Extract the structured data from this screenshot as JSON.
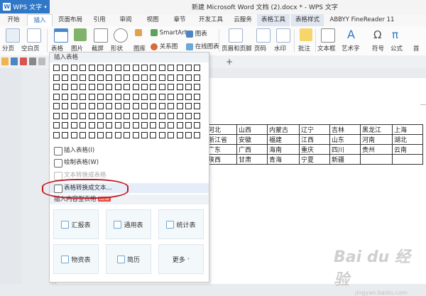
{
  "app": {
    "wps_button": "WPS 文字",
    "window_title": "新建 Microsoft Word 文档 (2).docx * - WPS 文字"
  },
  "tabs": [
    {
      "label": "开始"
    },
    {
      "label": "插入"
    },
    {
      "label": "页面布局"
    },
    {
      "label": "引用"
    },
    {
      "label": "审阅"
    },
    {
      "label": "视图"
    },
    {
      "label": "章节"
    },
    {
      "label": "开发工具"
    },
    {
      "label": "云服务"
    },
    {
      "label": "表格工具"
    },
    {
      "label": "表格样式"
    },
    {
      "label": "ABBYY FineReader 11"
    }
  ],
  "ribbon": {
    "page_break": "分页",
    "blank_page": "空白页",
    "table": "表格",
    "picture": "图片",
    "screenshot": "截屏",
    "shape": "形状",
    "smartart": "SmartArt",
    "chart": "图表",
    "gallery": "图库",
    "relation": "关系图",
    "online_chart": "在线图表",
    "header_footer": "页眉和页脚",
    "page_number": "页码",
    "watermark": "水印",
    "comment": "批注",
    "textbox": "文本框",
    "wordart": "艺术字",
    "symbol": "符号",
    "formula": "公式",
    "more": "首"
  },
  "dropdown": {
    "header": "插入表格",
    "items": [
      {
        "label": "插入表格(I)"
      },
      {
        "label": "绘制表格(W)"
      },
      {
        "label": "文本转换成表格"
      },
      {
        "label": "表格转换成文本..."
      },
      {
        "label": "插入内容型表格"
      }
    ],
    "new_badge": "NEW",
    "cards": [
      {
        "label": "汇报表"
      },
      {
        "label": "通用表"
      },
      {
        "label": "统计表"
      },
      {
        "label": "物资表"
      },
      {
        "label": "简历"
      },
      {
        "label": "更多"
      }
    ]
  },
  "document": {
    "table_rows": [
      [
        "河北",
        "山西",
        "内蒙古",
        "辽宁",
        "吉林",
        "黑龙江",
        "上海"
      ],
      [
        "浙江省",
        "安徽",
        "福建",
        "江西",
        "山东",
        "河南",
        "湖北"
      ],
      [
        "广东",
        "广西",
        "海南",
        "重庆",
        "四川",
        "贵州",
        "云南"
      ],
      [
        "陕西",
        "甘肃",
        "青海",
        "宁夏",
        "新疆",
        "",
        ""
      ]
    ]
  },
  "watermark": {
    "main": "Bai du 经验",
    "sub": "jingyan.baidu.com"
  },
  "colors": {
    "accent": "#2f78c7",
    "annotation": "#c21a24"
  }
}
